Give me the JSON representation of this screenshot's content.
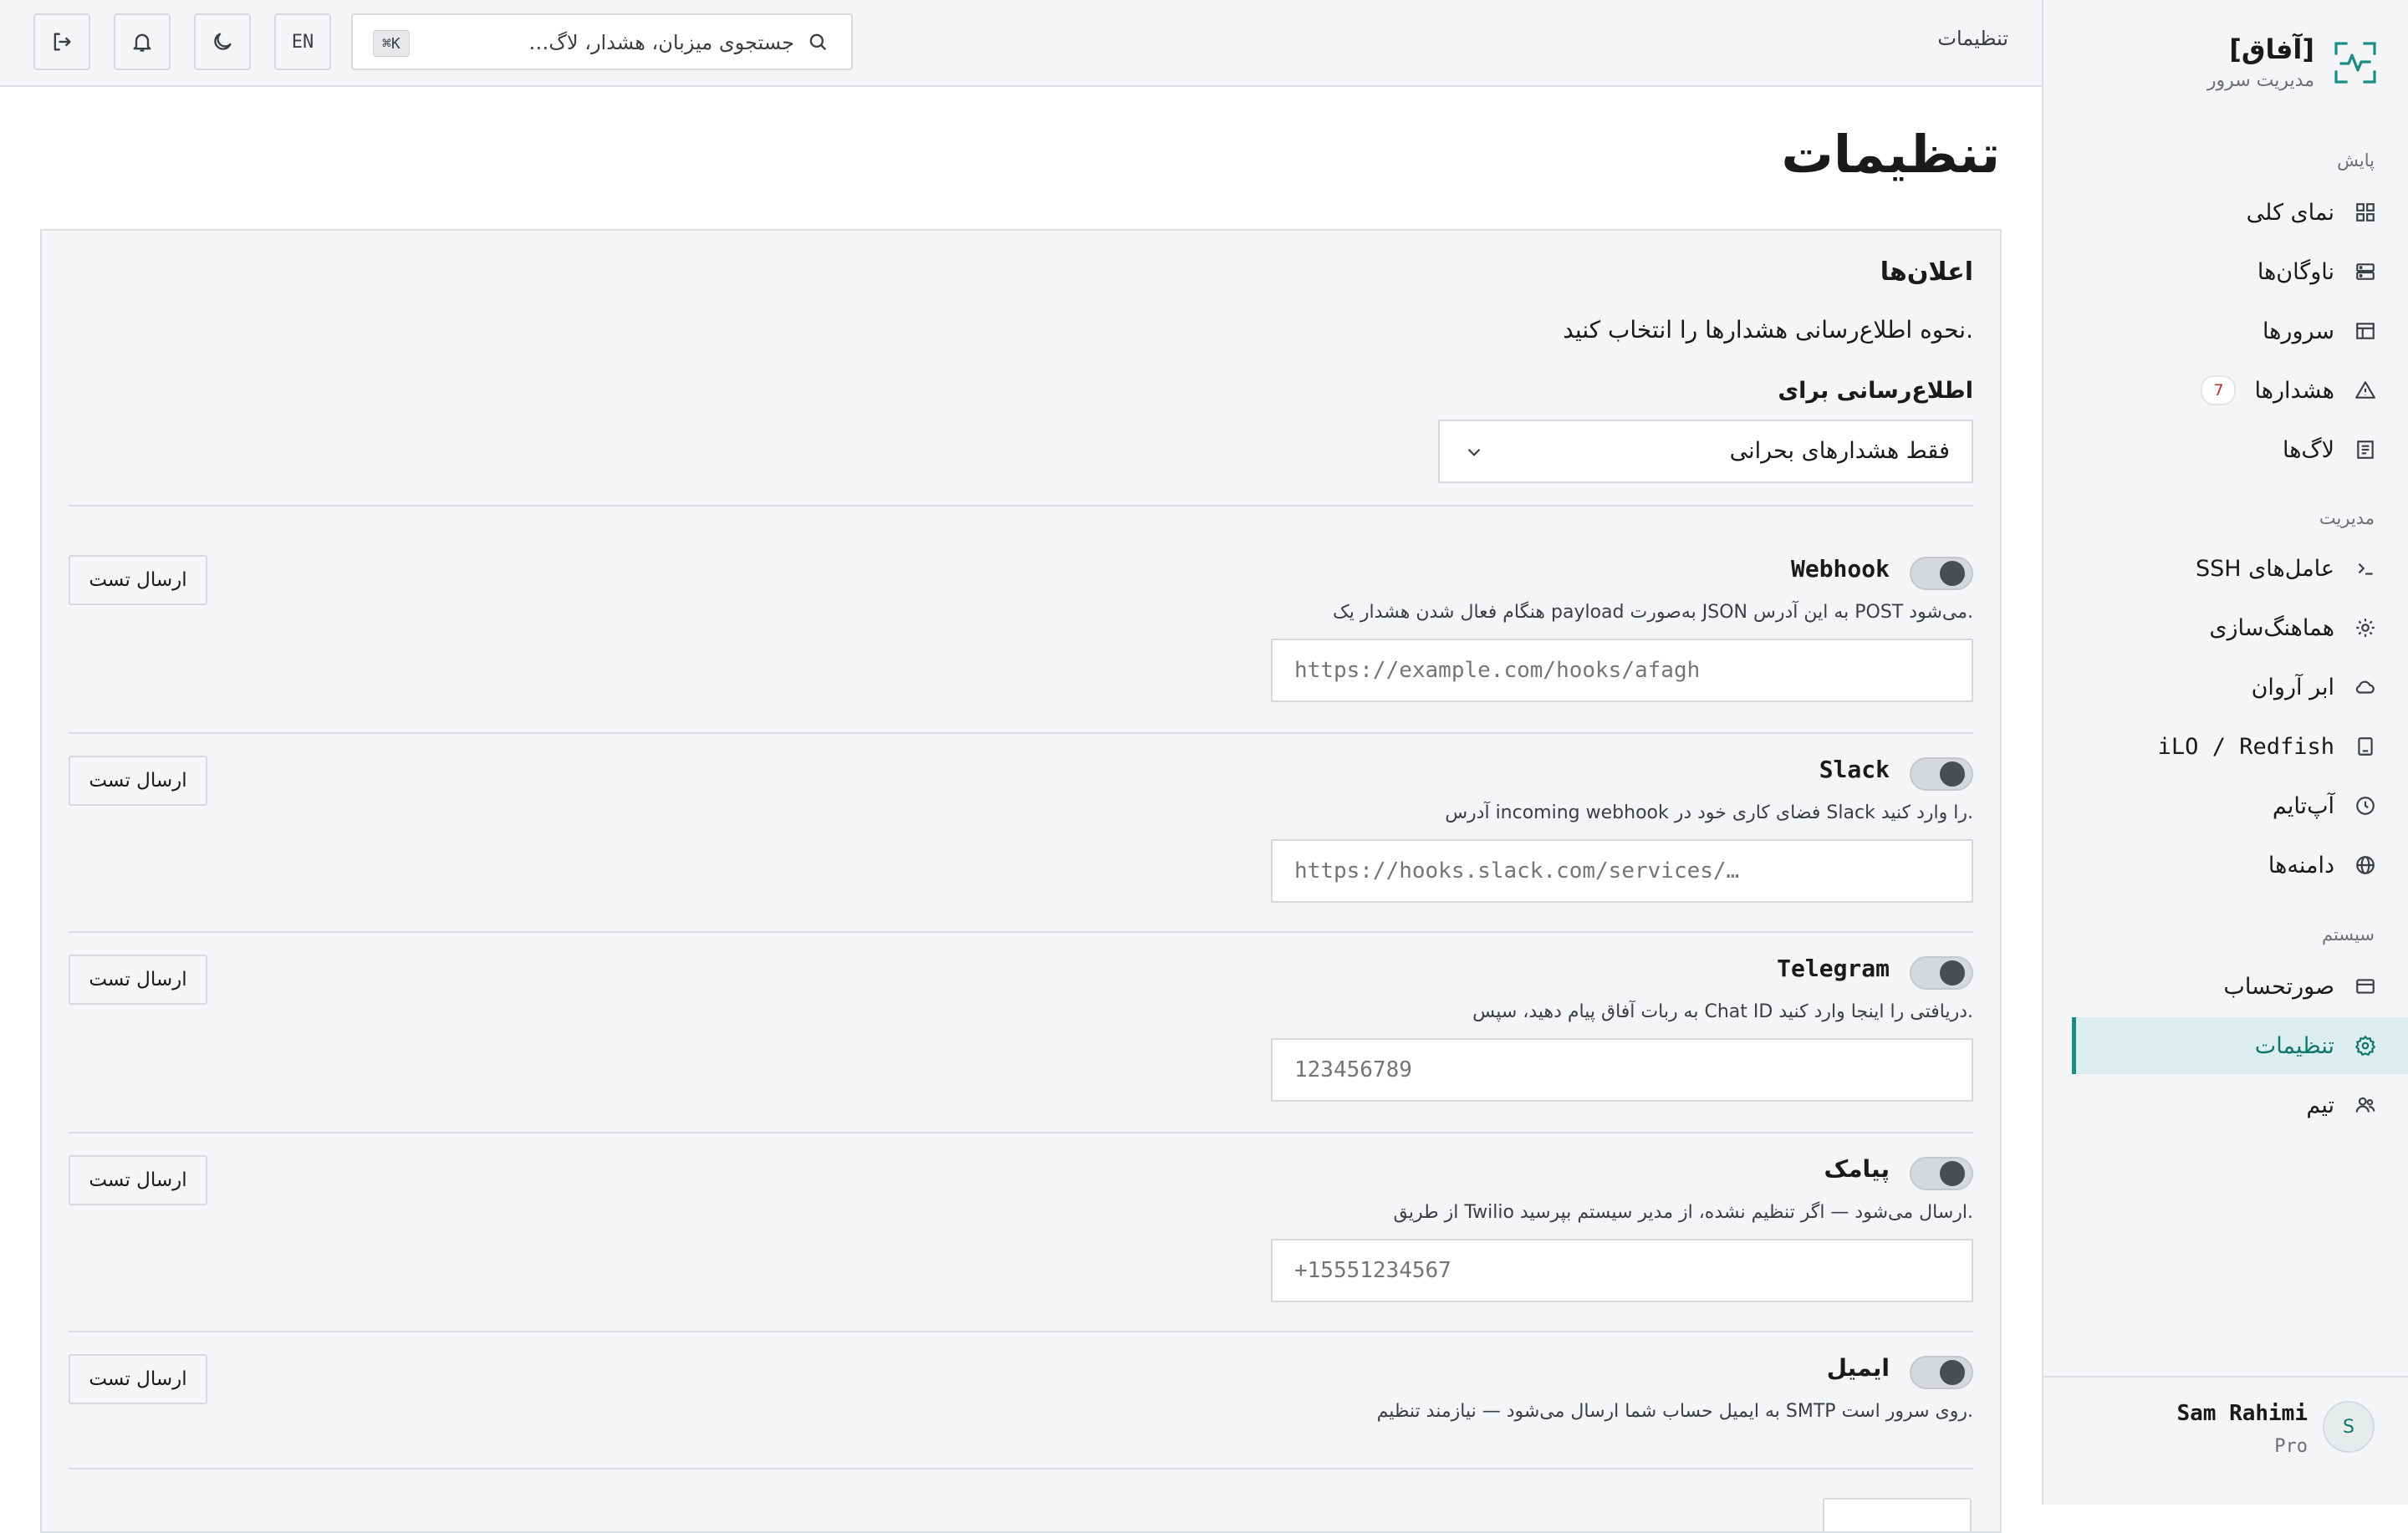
{
  "brand": {
    "name": "[آفاق]",
    "subtitle": "مدیریت سرور"
  },
  "sidebar": {
    "sections": [
      {
        "title": "پایش"
      },
      {
        "title": "مدیریت"
      },
      {
        "title": "سیستم"
      }
    ],
    "items": [
      {
        "label": "نمای کلی",
        "icon": "grid-icon"
      },
      {
        "label": "ناوگان‌ها",
        "icon": "server-stack-icon"
      },
      {
        "label": "سرورها",
        "icon": "table-icon"
      },
      {
        "label": "هشدارها",
        "icon": "alert-triangle-icon",
        "badge": "7"
      },
      {
        "label": "لاگ‌ها",
        "icon": "log-file-icon"
      },
      {
        "label": "عامل‌های SSH",
        "icon": "terminal-icon"
      },
      {
        "label": "هماهنگ‌سازی",
        "icon": "sync-gear-icon"
      },
      {
        "label": "ابر آروان",
        "icon": "cloud-icon"
      },
      {
        "label": "iLO / Redfish",
        "icon": "device-icon"
      },
      {
        "label": "آپ‌تایم",
        "icon": "clock-icon"
      },
      {
        "label": "دامنه‌ها",
        "icon": "globe-icon"
      },
      {
        "label": "صورتحساب",
        "icon": "credit-card-icon"
      },
      {
        "label": "تنظیمات",
        "icon": "gear-icon",
        "active": true
      },
      {
        "label": "تیم",
        "icon": "users-icon"
      }
    ],
    "user": {
      "initial": "S",
      "name": "Sam Rahimi",
      "plan": "Pro"
    }
  },
  "topbar": {
    "breadcrumb": "تنظیمات",
    "search_placeholder": "جستجوی میزبان، هشدار، لاگ…",
    "shortcut": "⌘K",
    "lang": "EN"
  },
  "page": {
    "title": "تنظیمات"
  },
  "notifications": {
    "title": "اعلان‌ها",
    "description": "نحوه اطلاع‌رسانی هشدارها را انتخاب کنید.",
    "notify_label": "اطلاع‌رسانی برای",
    "notify_value": "فقط هشدارهای بحرانی",
    "test_label": "ارسال تست",
    "channels": [
      {
        "name": "Webhook",
        "description": "هنگام فعال شدن هشدار یک payload به‌صورت JSON به این آدرس POST می‌شود.",
        "placeholder": "https://example.com/hooks/afagh",
        "enabled": false
      },
      {
        "name": "Slack",
        "description": "آدرس incoming webhook فضای کاری خود در Slack را وارد کنید.",
        "placeholder": "https://hooks.slack.com/services/…",
        "enabled": false
      },
      {
        "name": "Telegram",
        "description": "به ربات آفاق پیام دهید، سپس Chat ID دریافتی را اینجا وارد کنید.",
        "placeholder": "123456789",
        "enabled": false
      },
      {
        "name": "پیامک",
        "description": "از طریق Twilio ارسال می‌شود — اگر تنظیم نشده، از مدیر سیستم بپرسید.",
        "placeholder": "+15551234567",
        "enabled": false
      },
      {
        "name": "ایمیل",
        "description": "به ایمیل حساب شما ارسال می‌شود — نیازمند تنظیم SMTP روی سرور است.",
        "enabled": false
      }
    ]
  },
  "colors": {
    "accent": "#1a8e84",
    "active_bg": "#dceeed",
    "badge_text": "#b7322c"
  }
}
